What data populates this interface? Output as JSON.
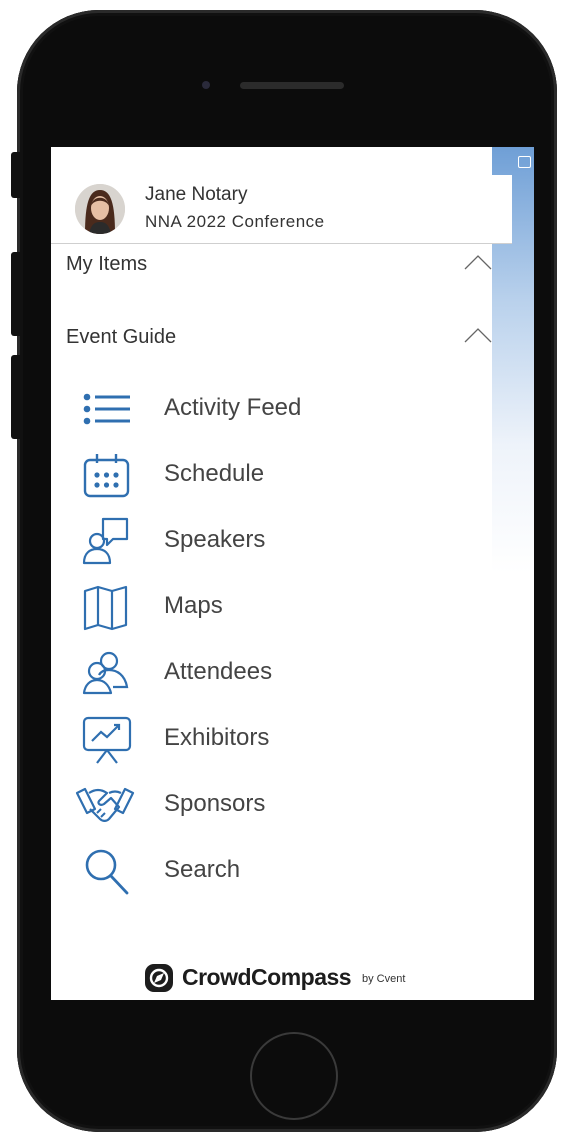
{
  "profile": {
    "name": "Jane Notary",
    "event": "NNA 2022 Conference"
  },
  "sections": {
    "my_items": "My Items",
    "event_guide": "Event Guide"
  },
  "menu": [
    {
      "label": "Activity Feed",
      "icon": "list-icon"
    },
    {
      "label": "Schedule",
      "icon": "calendar-icon"
    },
    {
      "label": "Speakers",
      "icon": "speaker-icon"
    },
    {
      "label": "Maps",
      "icon": "map-icon"
    },
    {
      "label": "Attendees",
      "icon": "attendees-icon"
    },
    {
      "label": "Exhibitors",
      "icon": "presentation-chart-icon"
    },
    {
      "label": "Sponsors",
      "icon": "handshake-icon"
    },
    {
      "label": "Search",
      "icon": "search-icon"
    }
  ],
  "footer": {
    "brand": "CrowdCompass",
    "by": "by Cvent"
  },
  "colors": {
    "icon": "#2f6fb0",
    "text": "#444444"
  }
}
